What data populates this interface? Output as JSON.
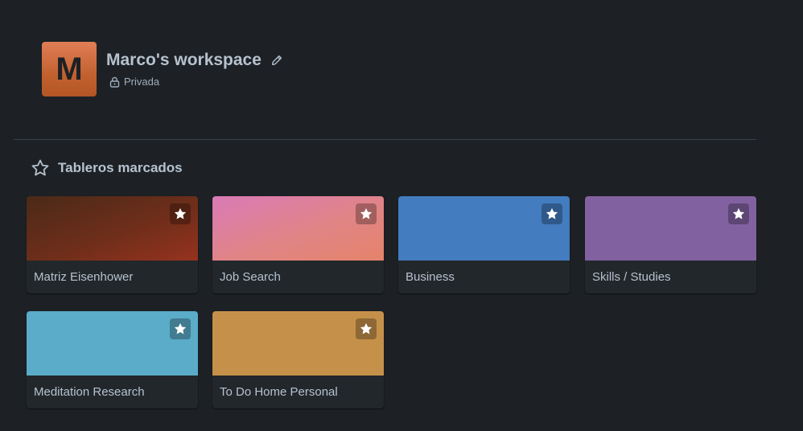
{
  "workspace": {
    "avatar_letter": "M",
    "title": "Marco's workspace",
    "visibility": "Privada",
    "avatar_color": "#c2612f"
  },
  "section": {
    "title": "Tableros marcados",
    "icon": "star-outline-icon"
  },
  "boards": [
    {
      "name": "Matriz Eisenhower",
      "cover": "gradient brown-red",
      "starred": true
    },
    {
      "name": "Job Search",
      "cover": "gradient pink-orange",
      "starred": true
    },
    {
      "name": "Business",
      "cover": "#437cbf",
      "starred": true
    },
    {
      "name": "Skills / Studies",
      "cover": "#8261a1",
      "starred": true
    },
    {
      "name": "Meditation Research",
      "cover": "#5aacc8",
      "starred": true
    },
    {
      "name": "To Do Home Personal",
      "cover": "#c5914a",
      "starred": true
    }
  ],
  "colors": {
    "background": "#1d2125",
    "text": "#b6c2cf",
    "card": "#22272b"
  }
}
